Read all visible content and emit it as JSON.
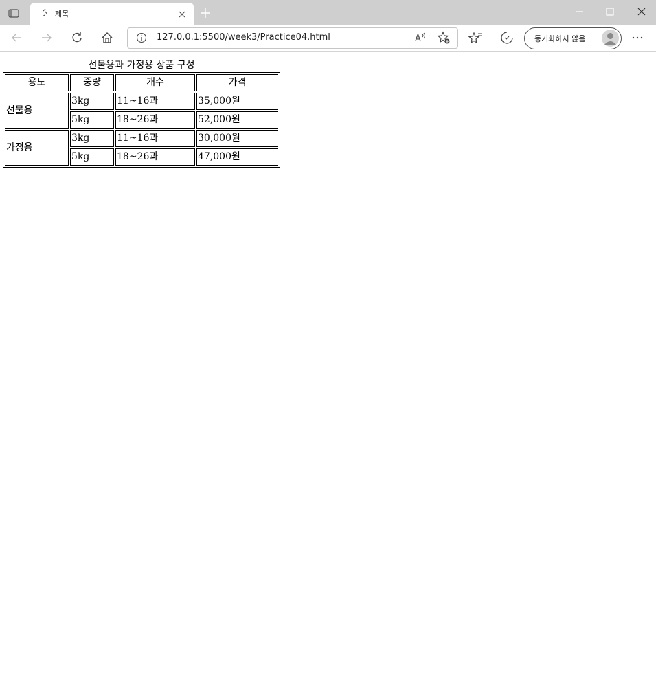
{
  "browser": {
    "tab_title": "제목",
    "url": "127.0.0.1:5500/week3/Practice04.html",
    "profile_label": "동기화하지 않음"
  },
  "page": {
    "caption": "선물용과 가정용 상품 구성",
    "headers": [
      "용도",
      "중량",
      "개수",
      "가격"
    ],
    "groups": [
      {
        "use": "선물용",
        "rows": [
          {
            "weight": "3kg",
            "count": "11~16과",
            "price": "35,000원"
          },
          {
            "weight": "5kg",
            "count": "18~26과",
            "price": "52,000원"
          }
        ]
      },
      {
        "use": "가정용",
        "rows": [
          {
            "weight": "3kg",
            "count": "11~16과",
            "price": "30,000원"
          },
          {
            "weight": "5kg",
            "count": "18~26과",
            "price": "47,000원"
          }
        ]
      }
    ]
  },
  "colors": {
    "tabbar_bg": "#cfcfcf",
    "table_border": "#000000"
  }
}
